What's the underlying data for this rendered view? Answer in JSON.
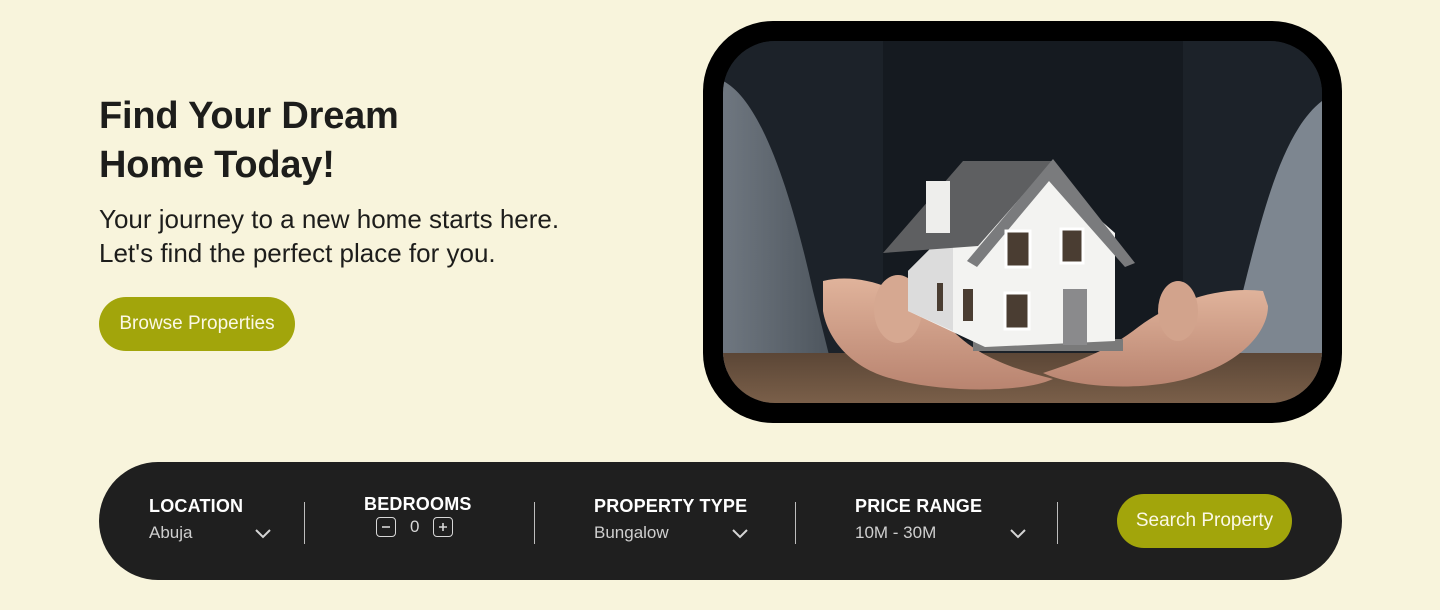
{
  "hero": {
    "title_line1": "Find Your Dream",
    "title_line2": "Home Today!",
    "subtitle_line1": "Your journey to a new home starts here.",
    "subtitle_line2": "Let's find the perfect place for you.",
    "browse_label": "Browse Properties"
  },
  "search": {
    "location_label": "LOCATION",
    "location_value": "Abuja",
    "bedrooms_label": "BEDROOMS",
    "bedrooms_value": "0",
    "property_type_label": "PROPERTY TYPE",
    "property_type_value": "Bungalow",
    "price_range_label": "PRICE RANGE",
    "price_range_value": "10M - 30M",
    "button_label": "Search Property"
  },
  "colors": {
    "background": "#f8f4dc",
    "accent": "#a2a50b",
    "search_bar": "#1f1f1f",
    "text": "#1d1d1b"
  },
  "icons": {
    "dropdown": "chevron-down-icon",
    "minus": "minus-icon",
    "plus": "plus-icon"
  }
}
